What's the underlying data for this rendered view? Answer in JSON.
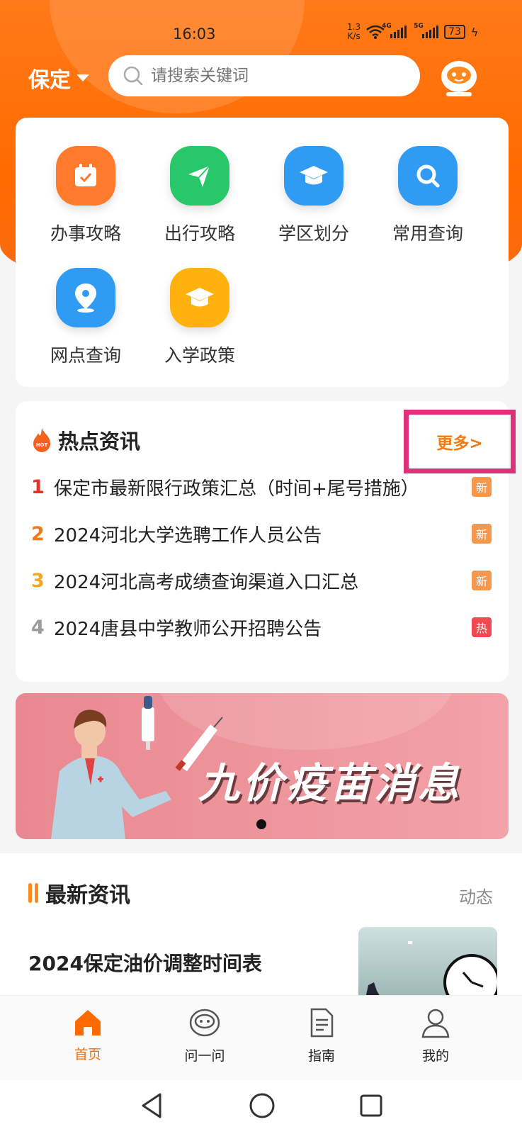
{
  "status_bar": {
    "time": "16:03",
    "speed_top": "1.3",
    "speed_bottom": "K/s",
    "net1": "4G",
    "net2": "5G",
    "battery": "73"
  },
  "header": {
    "city": "保定",
    "search_placeholder": "请搜索关键词"
  },
  "services": [
    {
      "label": "办事攻略",
      "icon": "calendar-check-icon",
      "color": "#ff7a2a"
    },
    {
      "label": "出行攻略",
      "icon": "paper-plane-icon",
      "color": "#28c76a"
    },
    {
      "label": "学区划分",
      "icon": "graduation-cap-icon",
      "color": "#2f9bf3"
    },
    {
      "label": "常用查询",
      "icon": "magnifier-icon",
      "color": "#2f9bf3"
    },
    {
      "label": "网点查询",
      "icon": "location-pin-icon",
      "color": "#2f9bf3"
    },
    {
      "label": "入学政策",
      "icon": "graduation-cap-icon",
      "color": "#ffb20d"
    }
  ],
  "hot_news": {
    "title": "热点资讯",
    "more": "更多>",
    "items": [
      {
        "rank": "1",
        "title": "保定市最新限行政策汇总（时间+尾号措施）",
        "tag": "新",
        "rank_color": "#e8312a",
        "tag_color": "#f5974c"
      },
      {
        "rank": "2",
        "title": "2024河北大学选聘工作人员公告",
        "tag": "新",
        "rank_color": "#f07a1a",
        "tag_color": "#f5974c"
      },
      {
        "rank": "3",
        "title": "2024河北高考成绩查询渠道入口汇总",
        "tag": "新",
        "rank_color": "#f5a623",
        "tag_color": "#f5974c"
      },
      {
        "rank": "4",
        "title": "2024唐县中学教师公开招聘公告",
        "tag": "热",
        "rank_color": "#9a9a9a",
        "tag_color": "#f0494f"
      }
    ]
  },
  "banner": {
    "text": "九价疫苗消息"
  },
  "latest": {
    "title": "最新资讯",
    "side": "动态",
    "article_title": "2024保定油价调整时间表"
  },
  "tabbar": [
    {
      "label": "首页",
      "icon": "home-icon",
      "active": true
    },
    {
      "label": "问一问",
      "icon": "robot-icon",
      "active": false
    },
    {
      "label": "指南",
      "icon": "document-icon",
      "active": false
    },
    {
      "label": "我的",
      "icon": "user-icon",
      "active": false
    }
  ],
  "colors": {
    "accent": "#ff6a00",
    "highlight_box": "#e0307a"
  }
}
